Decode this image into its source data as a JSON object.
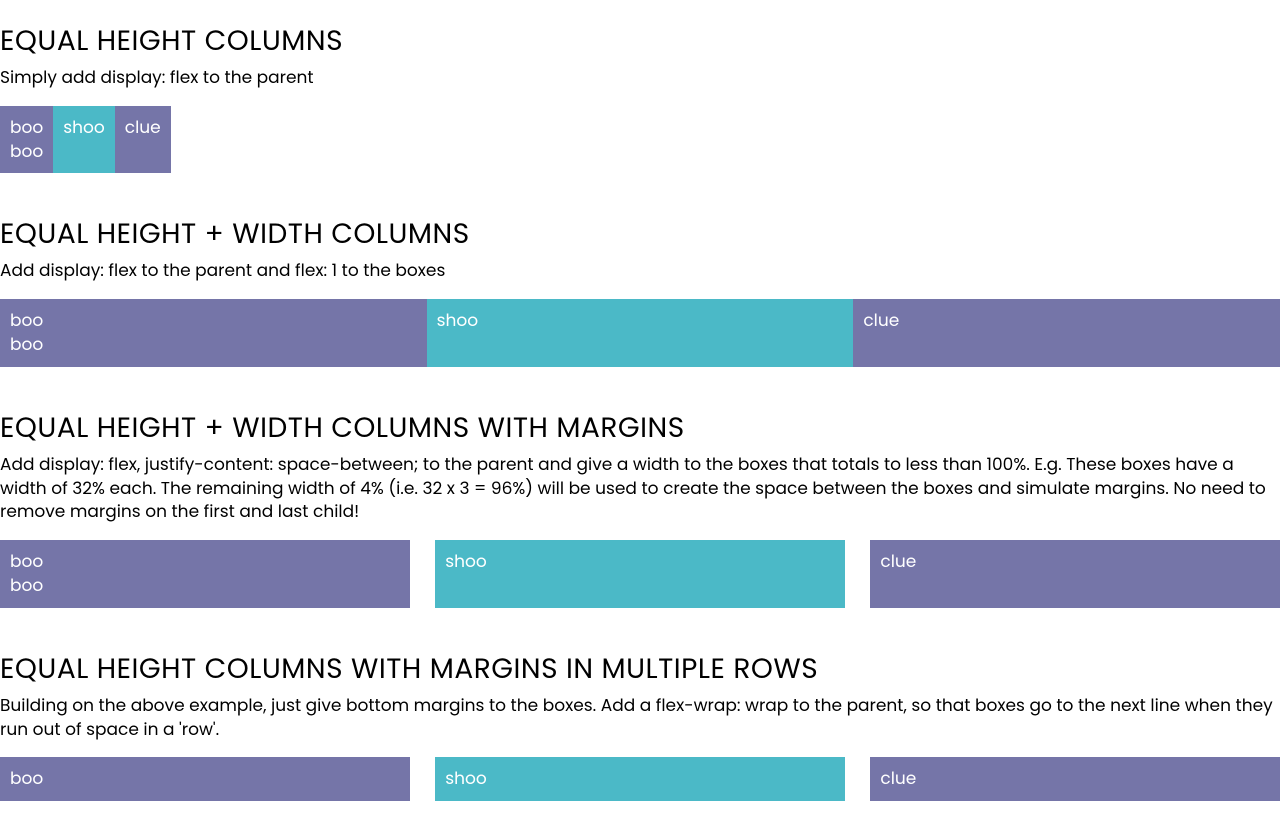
{
  "sections": [
    {
      "heading": "EQUAL HEIGHT COLUMNS",
      "desc": "Simply add display: flex to the parent",
      "boxes": [
        {
          "text": "boo\nboo",
          "color": "purple"
        },
        {
          "text": "shoo",
          "color": "teal"
        },
        {
          "text": "clue",
          "color": "purple"
        }
      ]
    },
    {
      "heading": "EQUAL HEIGHT + WIDTH COLUMNS",
      "desc": "Add display: flex to the parent and flex: 1 to the boxes",
      "boxes": [
        {
          "text": "boo\nboo",
          "color": "purple"
        },
        {
          "text": "shoo",
          "color": "teal"
        },
        {
          "text": "clue",
          "color": "purple"
        }
      ]
    },
    {
      "heading": "EQUAL HEIGHT + WIDTH COLUMNS WITH MARGINS",
      "desc": "Add display: flex, justify-content: space-between; to the parent and give a width to the boxes that totals to less than 100%. E.g. These boxes have a width of 32% each. The remaining width of 4% (i.e. 32 x 3 = 96%) will be used to create the space between the boxes and simulate margins. No need to remove margins on the first and last child!",
      "boxes": [
        {
          "text": "boo\nboo",
          "color": "purple"
        },
        {
          "text": "shoo",
          "color": "teal"
        },
        {
          "text": "clue",
          "color": "purple"
        }
      ]
    },
    {
      "heading": "EQUAL HEIGHT COLUMNS WITH MARGINS IN MULTIPLE ROWS",
      "desc": "Building on the above example, just give bottom margins to the boxes. Add a flex-wrap: wrap to the parent, so that boxes go to the next line when they run out of space in a 'row'.",
      "boxes": [
        {
          "text": "boo",
          "color": "purple"
        },
        {
          "text": "shoo",
          "color": "teal"
        },
        {
          "text": "clue",
          "color": "purple"
        }
      ]
    }
  ]
}
